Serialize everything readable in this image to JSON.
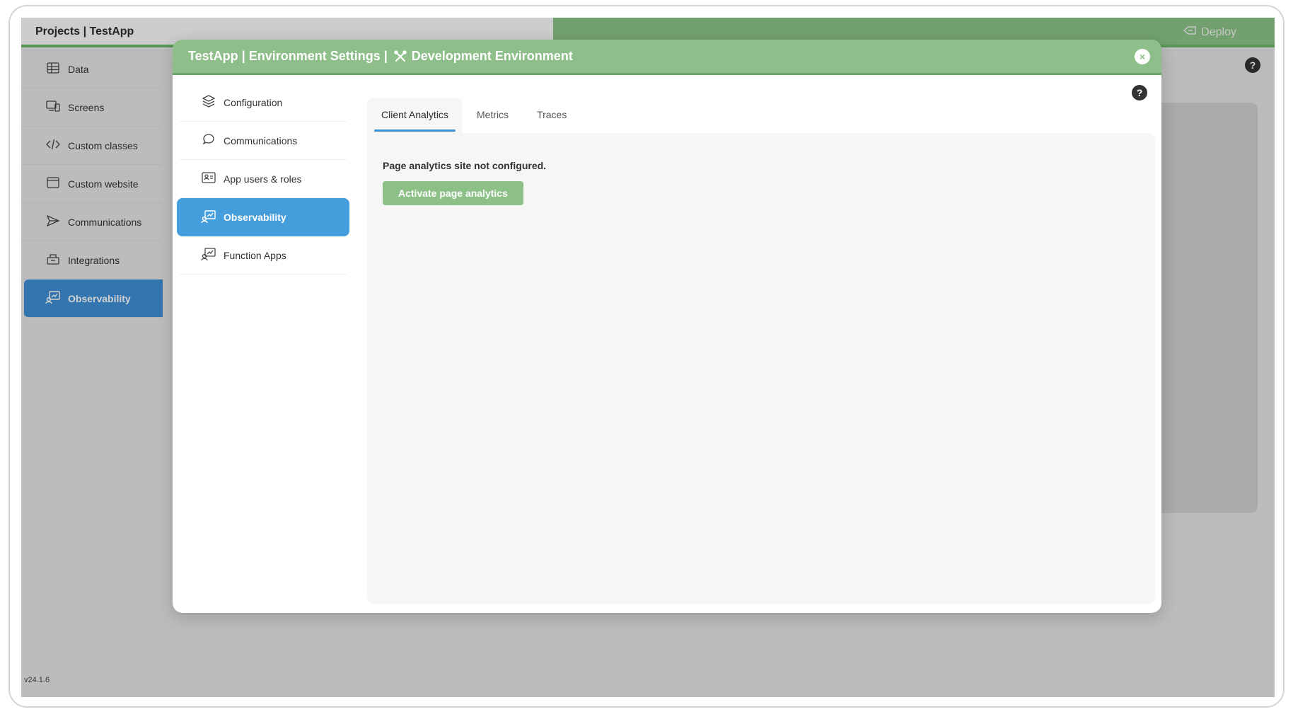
{
  "app": {
    "title": "Projects | TestApp",
    "deploy_label": "Deploy",
    "version": "v24.1.6",
    "sidebar": [
      {
        "label": "Data",
        "icon": "table-icon"
      },
      {
        "label": "Screens",
        "icon": "devices-icon"
      },
      {
        "label": "Custom classes",
        "icon": "code-icon"
      },
      {
        "label": "Custom website",
        "icon": "browser-window-icon"
      },
      {
        "label": "Communications",
        "icon": "send-icon"
      },
      {
        "label": "Integrations",
        "icon": "integrations-icon"
      },
      {
        "label": "Observability",
        "icon": "monitor-chart-icon",
        "active": true
      }
    ]
  },
  "modal": {
    "title_prefix": "TestApp | Environment Settings |",
    "environment": "Development Environment",
    "close_glyph": "×",
    "help_glyph": "?",
    "sidebar": [
      {
        "label": "Configuration",
        "icon": "layers-icon"
      },
      {
        "label": "Communications",
        "icon": "chat-bubble-icon"
      },
      {
        "label": "App users & roles",
        "icon": "users-card-icon"
      },
      {
        "label": "Observability",
        "icon": "monitor-chart-icon",
        "active": true
      },
      {
        "label": "Function Apps",
        "icon": "function-apps-icon"
      }
    ],
    "tabs": [
      {
        "label": "Client Analytics",
        "active": true
      },
      {
        "label": "Metrics"
      },
      {
        "label": "Traces"
      }
    ],
    "content": {
      "message": "Page analytics site not configured.",
      "activate_label": "Activate page analytics"
    }
  },
  "colors": {
    "header_green": "#8ebf8a",
    "active_blue": "#469ddb",
    "button_green": "#8cc087"
  }
}
